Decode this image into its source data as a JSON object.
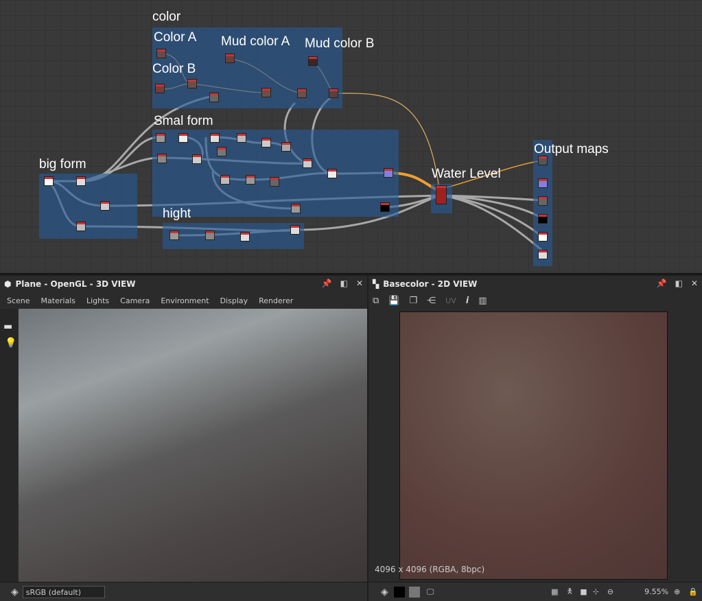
{
  "graph": {
    "frames": {
      "color": "color",
      "color_a": "Color A",
      "color_b": "Color B",
      "mud_a": "Mud color A",
      "mud_b": "Mud color B",
      "smal_form": "Smal form",
      "big_form": "big form",
      "hight": "hight",
      "water_level": "Water Level",
      "output_maps": "Output maps"
    }
  },
  "view3d": {
    "title": "Plane - OpenGL - 3D VIEW",
    "menu": [
      "Scene",
      "Materials",
      "Lights",
      "Camera",
      "Environment",
      "Display",
      "Renderer"
    ],
    "colorspace": "sRGB (default)"
  },
  "view2d": {
    "title": "Basecolor - 2D VIEW",
    "uv_label": "UV",
    "info_icon": "i",
    "resolution": "4096 x 4096 (RGBA, 8bpc)",
    "zoom": "9.55%"
  },
  "colors": {
    "frame": "#2b5f94",
    "wire": "#bdbdbd",
    "wire_orange": "#e8a03a"
  }
}
